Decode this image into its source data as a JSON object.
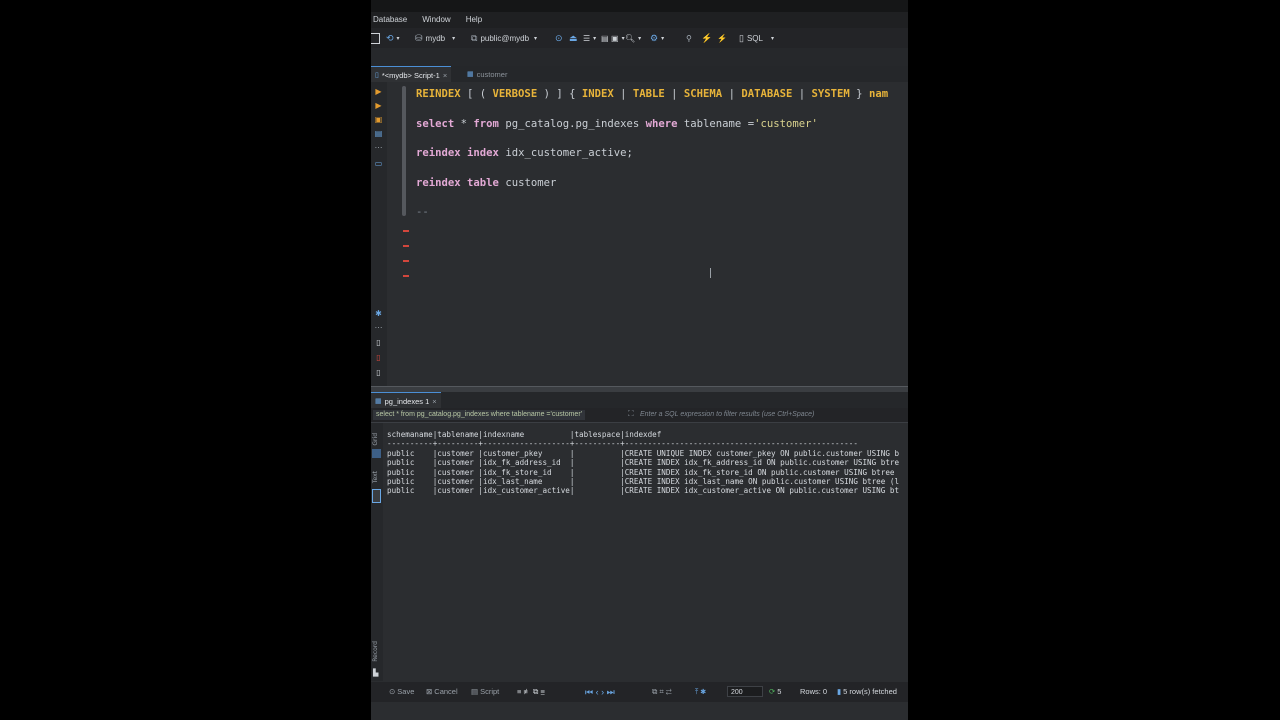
{
  "menu": [
    "Database",
    "Window",
    "Help"
  ],
  "toolbar": {
    "datasource": "mydb",
    "schema": "public@mydb",
    "mode": "SQL"
  },
  "tabs": [
    {
      "label": "*<mydb> Script-1",
      "close": "×"
    },
    {
      "label": "customer"
    }
  ],
  "editor": {
    "lines": [
      {
        "parts": [
          [
            "kw",
            "REINDEX"
          ],
          [
            "plain",
            " [ ( "
          ],
          [
            "kw",
            "VERBOSE"
          ],
          [
            "plain",
            " ) ] { "
          ],
          [
            "kw",
            "INDEX"
          ],
          [
            "plain",
            " | "
          ],
          [
            "kw",
            "TABLE"
          ],
          [
            "plain",
            " | "
          ],
          [
            "kw",
            "SCHEMA"
          ],
          [
            "plain",
            " | "
          ],
          [
            "kw",
            "DATABASE"
          ],
          [
            "plain",
            " | "
          ],
          [
            "kw",
            "SYSTEM"
          ],
          [
            "plain",
            " } "
          ],
          [
            "kw",
            "nam"
          ]
        ]
      },
      {
        "parts": [
          [
            "kw2",
            "select"
          ],
          [
            "plain",
            " * "
          ],
          [
            "kw2",
            "from"
          ],
          [
            "plain",
            " pg_catalog.pg_indexes "
          ],
          [
            "kw2",
            "where"
          ],
          [
            "plain",
            " tablename ="
          ],
          [
            "str",
            "'customer'"
          ]
        ]
      },
      {
        "parts": [
          [
            "kw2",
            "reindex"
          ],
          [
            "plain",
            " "
          ],
          [
            "kw2",
            "index"
          ],
          [
            "plain",
            " idx_customer_active;"
          ]
        ]
      },
      {
        "parts": [
          [
            "kw2",
            "reindex"
          ],
          [
            "plain",
            " "
          ],
          [
            "kw2",
            "table"
          ],
          [
            "plain",
            " customer"
          ]
        ]
      },
      {
        "parts": [
          [
            "cmt",
            "--"
          ]
        ]
      }
    ]
  },
  "results": {
    "tab_label": "pg_indexes 1",
    "tab_close": "×",
    "filter_query": "select * from pg_catalog.pg_indexes where tablename ='customer'",
    "filter_placeholder": "Enter a SQL expression to filter results (use Ctrl+Space)",
    "side_labels": [
      "Grid",
      "Text",
      "Record"
    ],
    "text_lines": [
      "schemaname|tablename|indexname          |tablespace|indexdef",
      "----------+---------+-------------------+----------+---------------------------------------------------",
      "public    |customer |customer_pkey      |          |CREATE UNIQUE INDEX customer_pkey ON public.customer USING b",
      "public    |customer |idx_fk_address_id  |          |CREATE INDEX idx_fk_address_id ON public.customer USING btre",
      "public    |customer |idx_fk_store_id    |          |CREATE INDEX idx_fk_store_id ON public.customer USING btree",
      "public    |customer |idx_last_name      |          |CREATE INDEX idx_last_name ON public.customer USING btree (l",
      "public    |customer |idx_customer_active|          |CREATE INDEX idx_customer_active ON public.customer USING bt"
    ]
  },
  "status": {
    "save": "Save",
    "cancel": "Cancel",
    "script": "Script",
    "fetch_size": "200",
    "count": "5",
    "rows": "Rows: 0",
    "fetched": "5 row(s) fetched"
  }
}
